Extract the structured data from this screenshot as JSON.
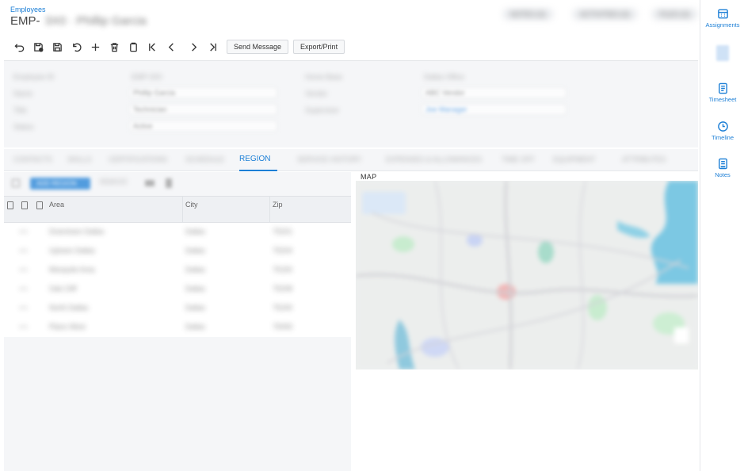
{
  "header": {
    "breadcrumb": "Employees",
    "title": "EMP-",
    "title_rest": "3X0 · Phillip Garcia",
    "pills": [
      "NOTES (0)",
      "ACTIVITIES (0)",
      "FILES (0)"
    ]
  },
  "toolbar": {
    "icons": [
      "undo-icon",
      "save-close-icon",
      "save-icon",
      "cancel-icon",
      "add-icon",
      "delete-icon",
      "copy-icon",
      "first-icon",
      "prev-icon",
      "next-icon",
      "last-icon"
    ],
    "send_message_label": "Send Message",
    "export_label": "Export/Print"
  },
  "form": {
    "labels_left": [
      "Employee ID",
      "Name",
      "Title",
      "Status"
    ],
    "values_left": [
      "EMP-3X0",
      "Phillip Garcia",
      "Technician",
      "Active"
    ],
    "labels_right": [
      "Home Base",
      "Vendor",
      "Supervisor"
    ],
    "values_right": [
      "Dallas Office",
      "ABC Vendor",
      "Joe Manager"
    ]
  },
  "tabs": [
    {
      "label": "CONTACTS",
      "active": false
    },
    {
      "label": "SKILLS",
      "active": false
    },
    {
      "label": "CERTIFICATIONS",
      "active": false
    },
    {
      "label": "SCHEDULE",
      "active": false
    },
    {
      "label": "REGION",
      "active": true
    },
    {
      "label": "SERVICE HISTORY",
      "active": false
    },
    {
      "label": "EXPENSES & ALLOWANCES",
      "active": false
    },
    {
      "label": "TIME OFF",
      "active": false
    },
    {
      "label": "EQUIPMENT",
      "active": false
    },
    {
      "label": "ATTRIBUTES",
      "active": false
    }
  ],
  "grid": {
    "toolbar": {
      "primary_label": "ADD REGION",
      "secondary_label": "REMOVE"
    },
    "columns": [
      "Area",
      "City",
      "Zip"
    ],
    "rows": [
      {
        "area": "Downtown Dallas",
        "city": "Dallas",
        "zip": "75201"
      },
      {
        "area": "Uptown Dallas",
        "city": "Dallas",
        "zip": "75204"
      },
      {
        "area": "Mesquite Area",
        "city": "Dallas",
        "zip": "75150"
      },
      {
        "area": "Oak Cliff",
        "city": "Dallas",
        "zip": "75208"
      },
      {
        "area": "North Dallas",
        "city": "Dallas",
        "zip": "75240"
      },
      {
        "area": "Plano West",
        "city": "Dallas",
        "zip": "75093"
      }
    ]
  },
  "map": {
    "label": "MAP"
  },
  "right_rail": [
    {
      "label": "Assignments",
      "icon": "calendar-grid-icon"
    },
    {
      "label": "",
      "icon": "document-icon"
    },
    {
      "label": "Timesheet",
      "icon": "timesheet-icon"
    },
    {
      "label": "Timeline",
      "icon": "clock-icon"
    },
    {
      "label": "Notes",
      "icon": "note-icon"
    }
  ],
  "colors": {
    "accent": "#1c7fd6",
    "panel": "#f5f6f8",
    "border": "#e4e6e9"
  }
}
